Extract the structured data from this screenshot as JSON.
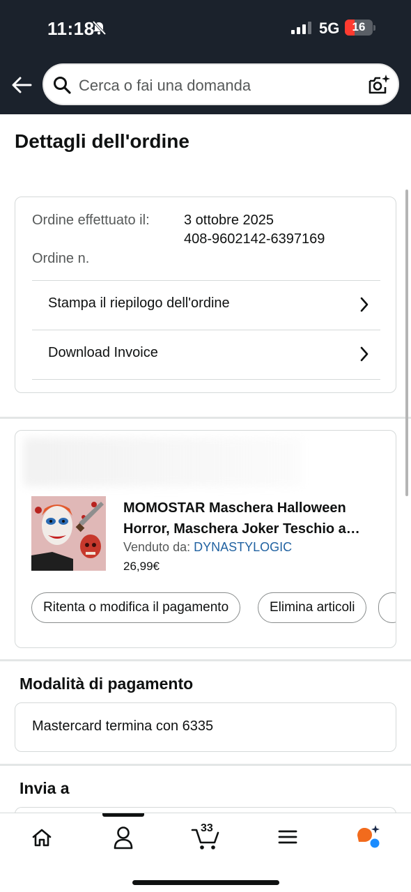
{
  "status_bar": {
    "time": "11:18",
    "network": "5G",
    "battery": "16"
  },
  "search": {
    "placeholder": "Cerca o fai una domanda"
  },
  "page_title": "Dettagli dell'ordine",
  "order_summary": {
    "placed_label": "Ordine effettuato il:",
    "placed_value": "3 ottobre 2025",
    "number_label": "Ordine n.",
    "number_value": "408-9602142-6397169",
    "links": [
      {
        "label": "Stampa il riepilogo dell'ordine"
      },
      {
        "label": "Download Invoice"
      }
    ]
  },
  "item": {
    "title": "MOMOSTAR Maschera Halloween Horror, Maschera Joker Teschio a…",
    "sold_by_label": "Venduto da:",
    "seller": "DYNASTYLOGIC",
    "price": "26,99€",
    "actions": [
      "Ritenta o modifica il pagamento",
      "Elimina articoli"
    ]
  },
  "payment": {
    "section_title": "Modalità di pagamento",
    "method": "Mastercard  termina con 6335"
  },
  "shipping": {
    "section_title": "Invia a"
  },
  "bottom_nav": {
    "items": [
      {
        "icon": "home-icon"
      },
      {
        "icon": "account-icon"
      },
      {
        "icon": "cart-icon",
        "count": "33"
      },
      {
        "icon": "menu-icon"
      },
      {
        "icon": "rufus-assistant-icon"
      }
    ],
    "active_index": 1
  },
  "colors": {
    "header_bg": "#1b222c",
    "link": "#2162a1",
    "text": "#0f1111",
    "muted": "#565959",
    "battery_low": "#ff3b30"
  }
}
